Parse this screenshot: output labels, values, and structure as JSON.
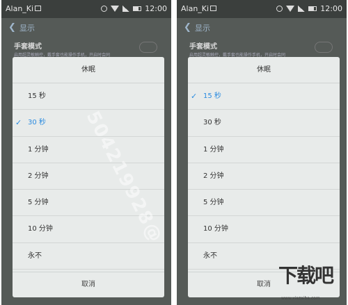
{
  "status_bar": {
    "carrier": "Alan_Ki",
    "time": "12:00"
  },
  "header": {
    "title": "显示"
  },
  "setting": {
    "title": "手套模式",
    "description": "启用超灵敏触控，戴手套也能操作手机，开启时会同"
  },
  "dialog": {
    "title": "休眠",
    "options": [
      "15 秒",
      "30 秒",
      "1 分钟",
      "2 分钟",
      "5 分钟",
      "10 分钟",
      "永不"
    ],
    "cancel_label": "取消"
  },
  "screens": [
    {
      "selected_option": "30 秒"
    },
    {
      "selected_option": "15 秒"
    }
  ],
  "colors": {
    "accent": "#2a8be0"
  },
  "watermark": {
    "diagonal": "504219928@",
    "brand": "下载吧",
    "small": "www.xiazaiba.com"
  }
}
